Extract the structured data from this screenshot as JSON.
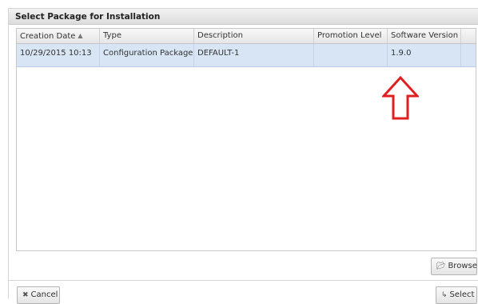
{
  "dialog": {
    "title": "Select Package for Installation"
  },
  "grid": {
    "columns": [
      {
        "label": "Creation Date",
        "sortable": true,
        "sort_icon": "sort-icon"
      },
      {
        "label": "Type"
      },
      {
        "label": "Description"
      },
      {
        "label": "Promotion Level"
      },
      {
        "label": "Software Version"
      }
    ],
    "rows": [
      {
        "creation_date": "10/29/2015 10:13",
        "type": "Configuration Package",
        "description": "DEFAULT-1",
        "promotion_level": "",
        "software_version": "1.9.0",
        "selected": true
      }
    ],
    "selected_row_color": "#d7e5f5"
  },
  "annotation": {
    "icon": "up-arrow-outline-icon",
    "color": "#e02020"
  },
  "buttons": {
    "browse": {
      "label": "Browse",
      "icon": "folder-open-icon"
    },
    "cancel": {
      "label": "Cancel",
      "icon": "close-x-icon"
    },
    "select": {
      "label": "Select",
      "icon": "return-arrow-icon"
    }
  }
}
